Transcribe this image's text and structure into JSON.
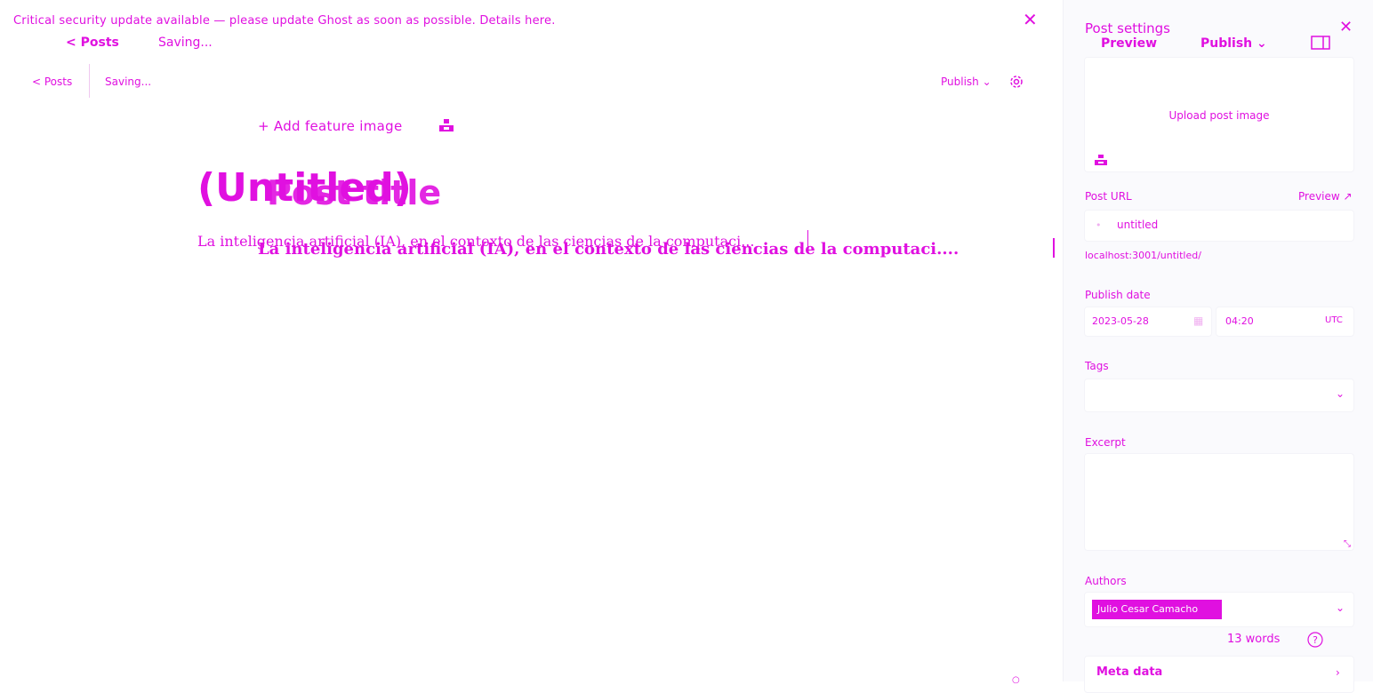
{
  "colors": {
    "accent": "#e010e0",
    "sidebar_bg": "#fafafd"
  },
  "banner": {
    "text": "Critical security update available — please update Ghost as soon as possible. Details here.",
    "close_icon": "close-icon"
  },
  "header_top": {
    "back_label": "< Posts",
    "status": "Saving..."
  },
  "editor_header": {
    "back_label": "< Posts",
    "status": "Saving...",
    "publish_label": "Publish ⌄",
    "settings_icon": "gear-icon"
  },
  "editor": {
    "add_feature_image": "+ Add feature image",
    "title_ghost": "(Untitled)",
    "title_placeholder": "Post title",
    "body_text_small": "La inteligencia artificial (IA), en el contexto de las ciencias de la computaci...",
    "body_text_large": "La inteligencia artificial (IA), en el contexto de las ciencias de la computaci...."
  },
  "sidebar": {
    "title": "Post settings",
    "preview_label": "Preview",
    "publish_label": "Publish ⌄",
    "upload_label": "Upload post image",
    "post_url_label": "Post URL",
    "preview_link": "Preview ↗",
    "url_slug": "untitled",
    "url_full": "localhost:3001/untitled/",
    "publish_date_label": "Publish date",
    "date_value": "2023-05-28",
    "time_value": "04:20",
    "timezone": "UTC",
    "tags_label": "Tags",
    "excerpt_label": "Excerpt",
    "authors_label": "Authors",
    "author_name": "Julio Cesar Camacho",
    "word_count": "13 words",
    "meta_data_label": "Meta data"
  }
}
